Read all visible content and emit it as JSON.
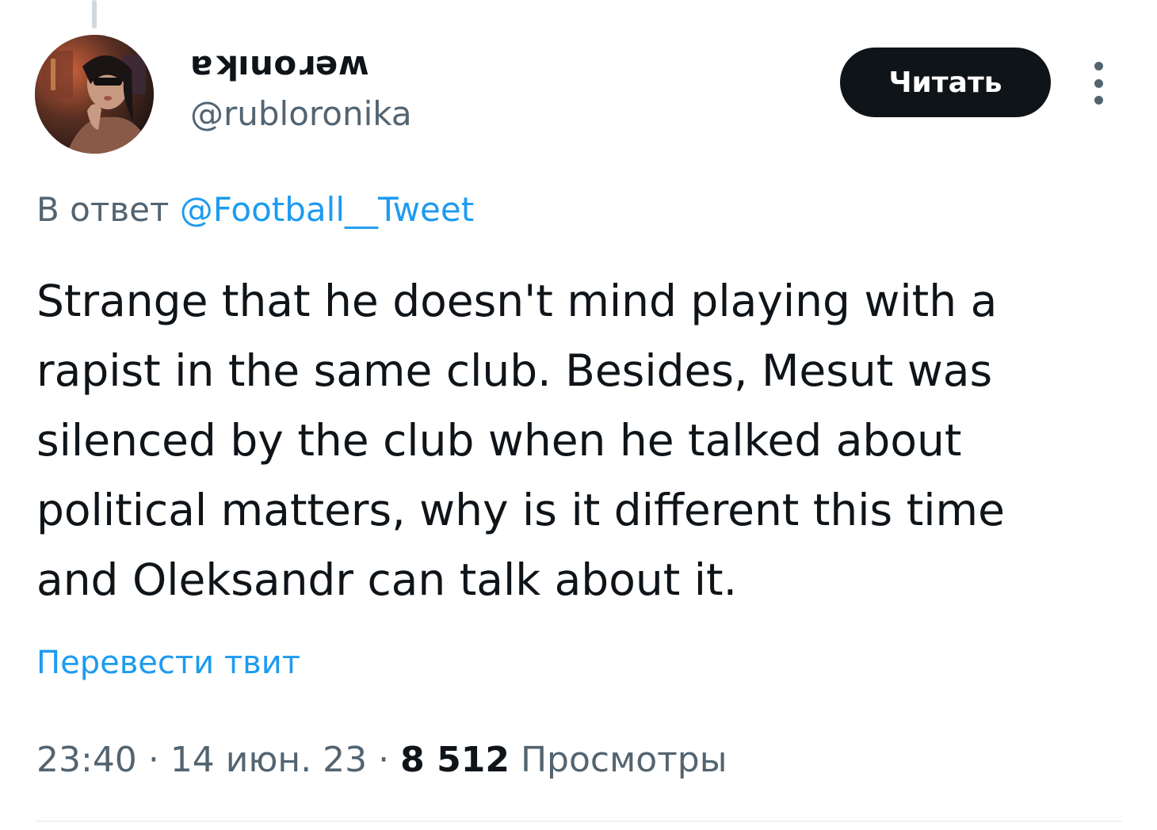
{
  "tweet": {
    "author": {
      "display_name": "ɐʞıuoɹǝʍ",
      "handle": "@rubloronika"
    },
    "follow_button_label": "Читать",
    "more_icon": "more-vertical-icon",
    "reply_to": {
      "prefix": "В ответ",
      "mention": "@Football__Tweet"
    },
    "text_lines": [
      "Strange that he doesn't mind playing with a",
      "rapist in the same club. Besides, Mesut was",
      "silenced by the club when he talked about",
      "political matters, why is it different this time",
      "and Oleksandr can talk about it."
    ],
    "translate_label": "Перевести твит",
    "meta": {
      "time": "23:40",
      "separator": "·",
      "date": "14 июн. 23",
      "views_count": "8 512",
      "views_label": "Просмотры"
    }
  },
  "colors": {
    "text": "#0f1419",
    "secondary": "#536471",
    "accent": "#1d9bf0",
    "button_bg": "#0f1419",
    "button_text": "#ffffff"
  }
}
